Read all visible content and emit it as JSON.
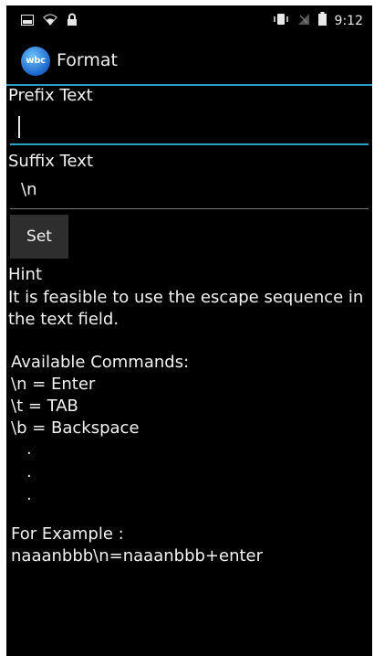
{
  "status_bar": {
    "time": "9:12",
    "left_icons": [
      "image-icon",
      "wifi-icon",
      "lock-icon"
    ],
    "right_icons": [
      "vibrate-icon",
      "no-signal-icon",
      "battery-icon"
    ]
  },
  "action_bar": {
    "logo_text": "wbc",
    "title": "Format",
    "accent_color": "#2aa0c4"
  },
  "form": {
    "prefix_label": "Prefix Text",
    "prefix_value": "",
    "suffix_label": "Suffix Text",
    "suffix_value": "\\n",
    "set_button": "Set"
  },
  "hint": {
    "title": "Hint",
    "line1": "It is feasible to use the escape sequence in",
    "line2": "the text field.",
    "commands_header": "Available Commands:",
    "commands": [
      "\\n = Enter",
      "\\t = TAB",
      "\\b = Backspace"
    ],
    "dots": [
      ".",
      ".",
      "."
    ],
    "example_header": "For Example :",
    "example": "naaanbbb\\n=naaanbbb+enter"
  }
}
